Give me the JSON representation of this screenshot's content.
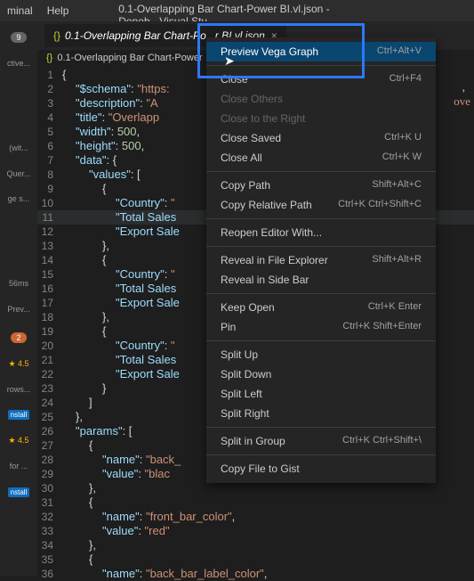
{
  "menubar": {
    "terminal": "minal",
    "help": "Help"
  },
  "title": "0.1-Overlapping Bar Chart-Power BI.vl.json - Deneb - Visual Stu",
  "tab": {
    "icon": "{}",
    "label": "0.1-Overlapping Bar Chart-Po...r BI.vl.json"
  },
  "breadcrumb": {
    "icon": "{}",
    "label": "0.1-Overlapping Bar Chart-Power",
    "more": "..."
  },
  "sidebar": {
    "badge": "9",
    "ctivelabel": "ctive...",
    "withlabel": "(wit...",
    "querlabel": "Quer...",
    "geslabel": "ge s...",
    "mslabel": "56ms",
    "prevlabel": "Prev...",
    "count": "2",
    "rating": "★ 4.5",
    "rowslabel": "rows...",
    "install": "nstall",
    "forlabel": "for ..."
  },
  "code_lines": [
    {
      "n": "1",
      "ind": 0,
      "tokens": [
        {
          "c": "p",
          "t": "{"
        }
      ]
    },
    {
      "n": "2",
      "ind": 1,
      "tokens": [
        {
          "c": "k",
          "t": "\"$schema\""
        },
        {
          "c": "p",
          "t": ": "
        },
        {
          "c": "s",
          "t": "\"https:"
        }
      ]
    },
    {
      "n": "3",
      "ind": 1,
      "tokens": [
        {
          "c": "k",
          "t": "\"description\""
        },
        {
          "c": "p",
          "t": ": "
        },
        {
          "c": "s",
          "t": "\"A "
        }
      ],
      "tail": true
    },
    {
      "n": "4",
      "ind": 1,
      "tokens": [
        {
          "c": "k",
          "t": "\"title\""
        },
        {
          "c": "p",
          "t": ": "
        },
        {
          "c": "s",
          "t": "\"Overlapp"
        }
      ]
    },
    {
      "n": "5",
      "ind": 1,
      "tokens": [
        {
          "c": "k",
          "t": "\"width\""
        },
        {
          "c": "p",
          "t": ": "
        },
        {
          "c": "n",
          "t": "500"
        },
        {
          "c": "p",
          "t": ","
        }
      ]
    },
    {
      "n": "6",
      "ind": 1,
      "tokens": [
        {
          "c": "k",
          "t": "\"height\""
        },
        {
          "c": "p",
          "t": ": "
        },
        {
          "c": "n",
          "t": "500"
        },
        {
          "c": "p",
          "t": ","
        }
      ]
    },
    {
      "n": "7",
      "ind": 1,
      "tokens": [
        {
          "c": "k",
          "t": "\"data\""
        },
        {
          "c": "p",
          "t": ": {"
        }
      ]
    },
    {
      "n": "8",
      "ind": 2,
      "tokens": [
        {
          "c": "k",
          "t": "\"values\""
        },
        {
          "c": "p",
          "t": ": ["
        }
      ]
    },
    {
      "n": "9",
      "ind": 3,
      "tokens": [
        {
          "c": "p",
          "t": "{"
        }
      ]
    },
    {
      "n": "10",
      "ind": 4,
      "tokens": [
        {
          "c": "k",
          "t": "\"Country\""
        },
        {
          "c": "p",
          "t": ": "
        },
        {
          "c": "s",
          "t": "\""
        }
      ]
    },
    {
      "n": "11",
      "ind": 4,
      "tokens": [
        {
          "c": "k",
          "t": "\"Total Sales"
        }
      ],
      "active": true
    },
    {
      "n": "12",
      "ind": 4,
      "tokens": [
        {
          "c": "k",
          "t": "\"Export Sale"
        }
      ]
    },
    {
      "n": "13",
      "ind": 3,
      "tokens": [
        {
          "c": "p",
          "t": "},"
        }
      ]
    },
    {
      "n": "14",
      "ind": 3,
      "tokens": [
        {
          "c": "p",
          "t": "{"
        }
      ]
    },
    {
      "n": "15",
      "ind": 4,
      "tokens": [
        {
          "c": "k",
          "t": "\"Country\""
        },
        {
          "c": "p",
          "t": ": "
        },
        {
          "c": "s",
          "t": "\""
        }
      ]
    },
    {
      "n": "16",
      "ind": 4,
      "tokens": [
        {
          "c": "k",
          "t": "\"Total Sales"
        }
      ]
    },
    {
      "n": "17",
      "ind": 4,
      "tokens": [
        {
          "c": "k",
          "t": "\"Export Sale"
        }
      ]
    },
    {
      "n": "18",
      "ind": 3,
      "tokens": [
        {
          "c": "p",
          "t": "},"
        }
      ]
    },
    {
      "n": "19",
      "ind": 3,
      "tokens": [
        {
          "c": "p",
          "t": "{"
        }
      ]
    },
    {
      "n": "20",
      "ind": 4,
      "tokens": [
        {
          "c": "k",
          "t": "\"Country\""
        },
        {
          "c": "p",
          "t": ": "
        },
        {
          "c": "s",
          "t": "\""
        }
      ]
    },
    {
      "n": "21",
      "ind": 4,
      "tokens": [
        {
          "c": "k",
          "t": "\"Total Sales"
        }
      ]
    },
    {
      "n": "22",
      "ind": 4,
      "tokens": [
        {
          "c": "k",
          "t": "\"Export Sale"
        }
      ]
    },
    {
      "n": "23",
      "ind": 3,
      "tokens": [
        {
          "c": "p",
          "t": "}"
        }
      ]
    },
    {
      "n": "24",
      "ind": 2,
      "tokens": [
        {
          "c": "p",
          "t": "]"
        }
      ]
    },
    {
      "n": "25",
      "ind": 1,
      "tokens": [
        {
          "c": "p",
          "t": "},"
        }
      ]
    },
    {
      "n": "26",
      "ind": 1,
      "tokens": [
        {
          "c": "k",
          "t": "\"params\""
        },
        {
          "c": "p",
          "t": ": ["
        }
      ]
    },
    {
      "n": "27",
      "ind": 2,
      "tokens": [
        {
          "c": "p",
          "t": "{"
        }
      ]
    },
    {
      "n": "28",
      "ind": 3,
      "tokens": [
        {
          "c": "k",
          "t": "\"name\""
        },
        {
          "c": "p",
          "t": ": "
        },
        {
          "c": "s",
          "t": "\"back_"
        }
      ]
    },
    {
      "n": "29",
      "ind": 3,
      "tokens": [
        {
          "c": "k",
          "t": "\"value\""
        },
        {
          "c": "p",
          "t": ": "
        },
        {
          "c": "s",
          "t": "\"blac"
        }
      ]
    },
    {
      "n": "30",
      "ind": 2,
      "tokens": [
        {
          "c": "p",
          "t": "},"
        }
      ]
    },
    {
      "n": "31",
      "ind": 2,
      "tokens": [
        {
          "c": "p",
          "t": "{"
        }
      ]
    },
    {
      "n": "32",
      "ind": 3,
      "tokens": [
        {
          "c": "k",
          "t": "\"name\""
        },
        {
          "c": "p",
          "t": ": "
        },
        {
          "c": "s",
          "t": "\"front_bar_color\""
        },
        {
          "c": "p",
          "t": ","
        }
      ]
    },
    {
      "n": "33",
      "ind": 3,
      "tokens": [
        {
          "c": "k",
          "t": "\"value\""
        },
        {
          "c": "p",
          "t": ": "
        },
        {
          "c": "s",
          "t": "\"red\""
        }
      ]
    },
    {
      "n": "34",
      "ind": 2,
      "tokens": [
        {
          "c": "p",
          "t": "},"
        }
      ]
    },
    {
      "n": "35",
      "ind": 2,
      "tokens": [
        {
          "c": "p",
          "t": "{"
        }
      ]
    },
    {
      "n": "36",
      "ind": 3,
      "tokens": [
        {
          "c": "k",
          "t": "\"name\""
        },
        {
          "c": "p",
          "t": ": "
        },
        {
          "c": "s",
          "t": "\"back_bar_label_color\""
        },
        {
          "c": "p",
          "t": ","
        }
      ]
    }
  ],
  "context_menu": [
    {
      "type": "item",
      "label": "Preview Vega Graph",
      "shortcut": "Ctrl+Alt+V",
      "highlight": true
    },
    {
      "type": "sep"
    },
    {
      "type": "item",
      "label": "Close",
      "shortcut": "Ctrl+F4"
    },
    {
      "type": "item",
      "label": "Close Others",
      "shortcut": "",
      "disabled": true
    },
    {
      "type": "item",
      "label": "Close to the Right",
      "shortcut": "",
      "disabled": true
    },
    {
      "type": "item",
      "label": "Close Saved",
      "shortcut": "Ctrl+K U"
    },
    {
      "type": "item",
      "label": "Close All",
      "shortcut": "Ctrl+K W"
    },
    {
      "type": "sep"
    },
    {
      "type": "item",
      "label": "Copy Path",
      "shortcut": "Shift+Alt+C"
    },
    {
      "type": "item",
      "label": "Copy Relative Path",
      "shortcut": "Ctrl+K Ctrl+Shift+C"
    },
    {
      "type": "sep"
    },
    {
      "type": "item",
      "label": "Reopen Editor With...",
      "shortcut": ""
    },
    {
      "type": "sep"
    },
    {
      "type": "item",
      "label": "Reveal in File Explorer",
      "shortcut": "Shift+Alt+R"
    },
    {
      "type": "item",
      "label": "Reveal in Side Bar",
      "shortcut": ""
    },
    {
      "type": "sep"
    },
    {
      "type": "item",
      "label": "Keep Open",
      "shortcut": "Ctrl+K Enter"
    },
    {
      "type": "item",
      "label": "Pin",
      "shortcut": "Ctrl+K Shift+Enter"
    },
    {
      "type": "sep"
    },
    {
      "type": "item",
      "label": "Split Up",
      "shortcut": ""
    },
    {
      "type": "item",
      "label": "Split Down",
      "shortcut": ""
    },
    {
      "type": "item",
      "label": "Split Left",
      "shortcut": ""
    },
    {
      "type": "item",
      "label": "Split Right",
      "shortcut": ""
    },
    {
      "type": "sep"
    },
    {
      "type": "item",
      "label": "Split in Group",
      "shortcut": "Ctrl+K Ctrl+Shift+\\"
    },
    {
      "type": "sep"
    },
    {
      "type": "item",
      "label": "Copy File to Gist",
      "shortcut": ""
    }
  ],
  "code_tail": {
    "comma": ",",
    "over": "ove"
  }
}
